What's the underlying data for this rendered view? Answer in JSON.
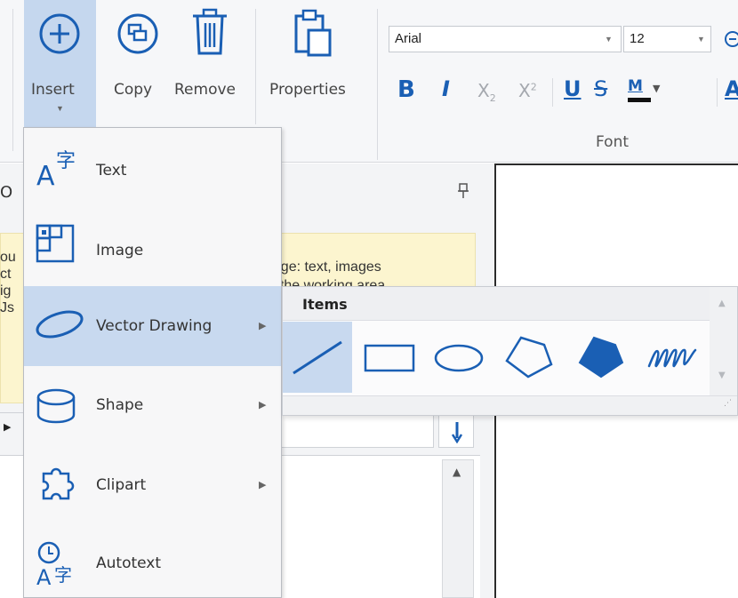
{
  "ribbon": {
    "insert_label": "Insert",
    "copy_label": "Copy",
    "remove_label": "Remove",
    "properties_label": "Properties",
    "font_group_label": "Font",
    "font_name": "Arial",
    "font_size": "12",
    "subscript_label": "X",
    "subscript_suffix": "2",
    "superscript_label": "X",
    "superscript_suffix": "2",
    "bold_label": "B",
    "italic_label": "I",
    "underline_label": "U",
    "strike_label": "S",
    "highlight_label": "M",
    "font_color_label": "A"
  },
  "pane": {
    "title_fragment": "O",
    "pin_icon": "pin-icon",
    "hint_lines": [
      "ou",
      "ct",
      "ig",
      "Js"
    ],
    "hint_right_1": "page: text, images",
    "hint_right_2": "in the working area"
  },
  "insert_menu": {
    "items": [
      {
        "label": "Text",
        "icon": "text-insert-icon",
        "has_submenu": false
      },
      {
        "label": "Image",
        "icon": "image-insert-icon",
        "has_submenu": false
      },
      {
        "label": "Vector Drawing",
        "icon": "ellipse-icon",
        "has_submenu": true
      },
      {
        "label": "Shape",
        "icon": "cylinder-shape-icon",
        "has_submenu": true
      },
      {
        "label": "Clipart",
        "icon": "puzzle-icon",
        "has_submenu": true
      },
      {
        "label": "Autotext",
        "icon": "autotext-icon",
        "has_submenu": false
      }
    ]
  },
  "submenu": {
    "title": "Items",
    "items": [
      "line-tool-icon",
      "rectangle-tool-icon",
      "ellipse-tool-icon",
      "polygon-tool-icon",
      "filled-polygon-tool-icon",
      "freehand-tool-icon"
    ]
  },
  "colors": {
    "accent": "#1a5fb4",
    "highlight": "#c8d9ef",
    "hint_bg": "#fcf5cf"
  }
}
